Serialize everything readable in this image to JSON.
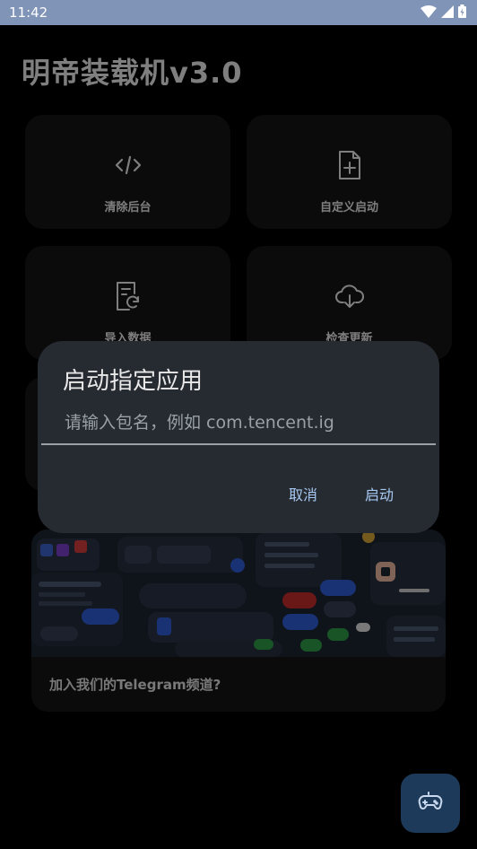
{
  "status_bar": {
    "time": "11:42"
  },
  "app": {
    "title": "明帝装载机v3.0"
  },
  "cards": [
    {
      "label": "清除后台",
      "icon": "code-icon"
    },
    {
      "label": "自定义启动",
      "icon": "file-add-icon"
    },
    {
      "label": "导入数据",
      "icon": "file-sync-icon"
    },
    {
      "label": "检查更新",
      "icon": "cloud-download-icon"
    }
  ],
  "banner": {
    "text": "加入我们的Telegram频道?"
  },
  "dialog": {
    "title": "启动指定应用",
    "input_placeholder": "请输入包名，例如 com.tencent.ig",
    "input_value": "",
    "cancel_label": "取消",
    "confirm_label": "启动"
  },
  "fab": {
    "icon": "gamepad-icon"
  },
  "colors": {
    "accent": "#a7c8f2",
    "status_bar": "#8094b8",
    "dialog_bg": "#262a31",
    "card_bg": "#151515"
  }
}
